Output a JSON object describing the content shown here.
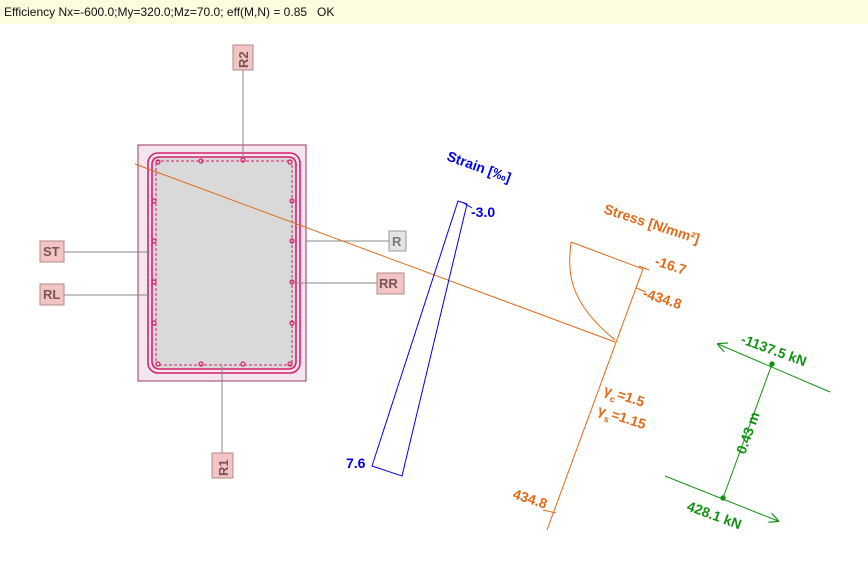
{
  "header": {
    "status_text": "Efficiency Nx=-600.0;My=320.0;Mz=70.0; eff(M,N) = 0.85   OK"
  },
  "section": {
    "rebar_tags": {
      "r2": "R2",
      "r1": "R1",
      "st": "ST",
      "rl": "RL",
      "r": "R",
      "rr": "RR"
    }
  },
  "strain": {
    "title": "Strain [‰]",
    "top_value": "-3.0",
    "bottom_value": "7.6"
  },
  "stress": {
    "title": "Stress [N/mm²]",
    "concrete_value": "-16.7",
    "steel_comp_value": "-434.8",
    "steel_tens_value": "434.8",
    "gamma_c": "γ",
    "gamma_c_sub": "c",
    "gamma_c_value": "=1.5",
    "gamma_s": "γ",
    "gamma_s_sub": "s",
    "gamma_s_value": "=1.15"
  },
  "forces": {
    "compression": "-1137.5 kN",
    "tension": "428.1 kN",
    "lever_arm": "0.43 m"
  },
  "colors": {
    "strain": "#0000e6",
    "stress": "#e06a17",
    "forces": "#139113",
    "reinforcement": "#d6206e",
    "section_fill": "#d9d9d9",
    "tag_fill": "#f2c4c4"
  }
}
